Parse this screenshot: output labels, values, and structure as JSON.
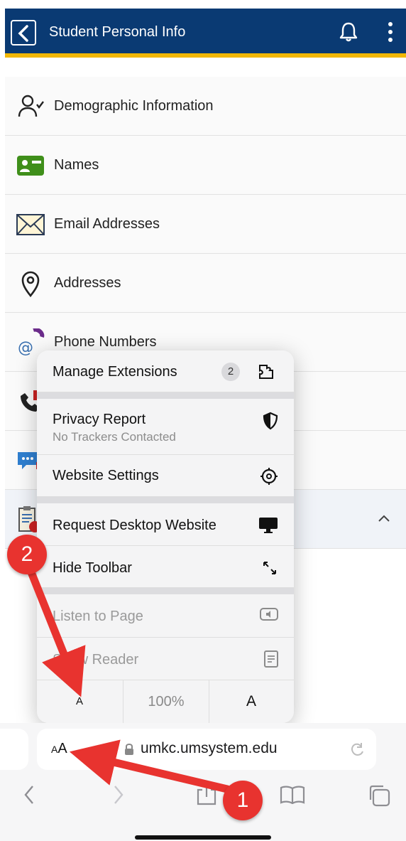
{
  "header": {
    "title": "Student Personal Info"
  },
  "list": {
    "items": [
      {
        "label": "Demographic Information",
        "icon": "person-check-icon"
      },
      {
        "label": "Names",
        "icon": "id-card-icon"
      },
      {
        "label": "Email Addresses",
        "icon": "envelope-icon"
      },
      {
        "label": "Addresses",
        "icon": "location-pin-icon"
      },
      {
        "label": "Phone Numbers",
        "icon": "phone-at-icon"
      },
      {
        "label": "",
        "icon": "phone-icon"
      },
      {
        "label": "",
        "icon": "chat-icon"
      },
      {
        "label": "",
        "icon": "clipboard-icon"
      }
    ]
  },
  "menu": {
    "manage_extensions": "Manage Extensions",
    "extensions_count": "2",
    "privacy_report": "Privacy Report",
    "privacy_sub": "No Trackers Contacted",
    "website_settings": "Website Settings",
    "request_desktop": "Request Desktop Website",
    "hide_toolbar": "Hide Toolbar",
    "listen_to_page": "Listen to Page",
    "show_reader": "Show Reader",
    "zoom_small": "A",
    "zoom_level": "100%",
    "zoom_large": "A"
  },
  "address_bar": {
    "aa_small": "A",
    "aa_large": "A",
    "url": "umkc.umsystem.edu"
  },
  "annotations": {
    "badge1": "1",
    "badge2": "2"
  },
  "colors": {
    "header": "#0a3a73",
    "accent": "#f2b705",
    "annotation": "#e8332f"
  }
}
